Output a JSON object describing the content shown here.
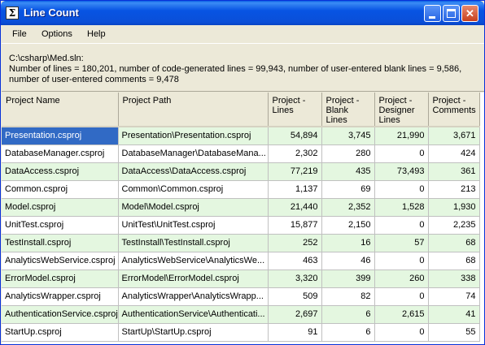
{
  "window": {
    "title": "Line Count"
  },
  "menu": [
    "File",
    "Options",
    "Help"
  ],
  "info": {
    "path": "C:\\csharp\\Med.sln:",
    "line1": "Number of lines = 180,201, number of code-generated lines = 99,943, number of user-entered blank lines = 9,586,",
    "line2": "number of user-entered comments = 9,478"
  },
  "columns": [
    "Project Name",
    "Project Path",
    "Project - Lines",
    "Project - Blank Lines",
    "Project - Designer Lines",
    "Project - Comments"
  ],
  "rows": [
    [
      "Presentation.csproj",
      "Presentation\\Presentation.csproj",
      "54,894",
      "3,745",
      "21,990",
      "3,671"
    ],
    [
      "DatabaseManager.csproj",
      "DatabaseManager\\DatabaseMana...",
      "2,302",
      "280",
      "0",
      "424"
    ],
    [
      "DataAccess.csproj",
      "DataAccess\\DataAccess.csproj",
      "77,219",
      "435",
      "73,493",
      "361"
    ],
    [
      "Common.csproj",
      "Common\\Common.csproj",
      "1,137",
      "69",
      "0",
      "213"
    ],
    [
      "Model.csproj",
      "Model\\Model.csproj",
      "21,440",
      "2,352",
      "1,528",
      "1,930"
    ],
    [
      "UnitTest.csproj",
      "UnitTest\\UnitTest.csproj",
      "15,877",
      "2,150",
      "0",
      "2,235"
    ],
    [
      "TestInstall.csproj",
      "TestInstall\\TestInstall.csproj",
      "252",
      "16",
      "57",
      "68"
    ],
    [
      "AnalyticsWebService.csproj",
      "AnalyticsWebService\\AnalyticsWe...",
      "463",
      "46",
      "0",
      "68"
    ],
    [
      "ErrorModel.csproj",
      "ErrorModel\\ErrorModel.csproj",
      "3,320",
      "399",
      "260",
      "338"
    ],
    [
      "AnalyticsWrapper.csproj",
      "AnalyticsWrapper\\AnalyticsWrapp...",
      "509",
      "82",
      "0",
      "74"
    ],
    [
      "AuthenticationService.csproj",
      "AuthenticationService\\Authenticati...",
      "2,697",
      "6",
      "2,615",
      "41"
    ],
    [
      "StartUp.csproj",
      "StartUp\\StartUp.csproj",
      "91",
      "6",
      "0",
      "55"
    ]
  ]
}
